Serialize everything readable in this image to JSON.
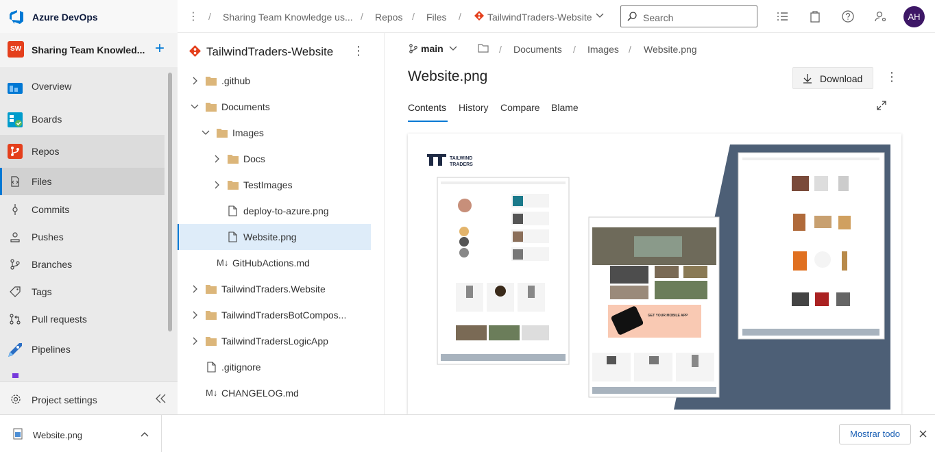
{
  "app": {
    "name": "Azure DevOps"
  },
  "breadcrumb": [
    "Sharing Team Knowledge us...",
    "Repos",
    "Files",
    "TailwindTraders-Website"
  ],
  "search": {
    "placeholder": "Search"
  },
  "user": {
    "initials": "AH"
  },
  "project": {
    "badge": "SW",
    "name": "Sharing Team Knowled..."
  },
  "nav": {
    "overview": "Overview",
    "boards": "Boards",
    "repos": "Repos",
    "files": "Files",
    "commits": "Commits",
    "pushes": "Pushes",
    "branches": "Branches",
    "tags": "Tags",
    "pull_requests": "Pull requests",
    "pipelines": "Pipelines",
    "settings": "Project settings"
  },
  "tree": {
    "repo": "TailwindTraders-Website",
    "items": [
      ".github",
      "Documents",
      "Images",
      "Docs",
      "TestImages",
      "deploy-to-azure.png",
      "Website.png",
      "GitHubActions.md",
      "TailwindTraders.Website",
      "TailwindTradersBotCompos...",
      "TailwindTradersLogicApp",
      ".gitignore",
      "CHANGELOG.md"
    ]
  },
  "main": {
    "branch": "main",
    "path": [
      "Documents",
      "Images",
      "Website.png"
    ],
    "title": "Website.png",
    "download": "Download",
    "tabs": [
      "Contents",
      "History",
      "Compare",
      "Blame"
    ]
  },
  "preview": {
    "brand_line1": "TAILWIND",
    "brand_line2": "TRADERS",
    "phone_banner": "GET YOUR MOBILE APP"
  },
  "download_bar": {
    "file": "Website.png",
    "show_all": "Mostrar todo"
  },
  "colors": {
    "accent": "#0078d4",
    "avatar": "#3d1766",
    "badge": "#e43f1c",
    "folder": "#dcb67a",
    "preview_bg": "#4d5f76",
    "banner": "#f9c9b3"
  }
}
